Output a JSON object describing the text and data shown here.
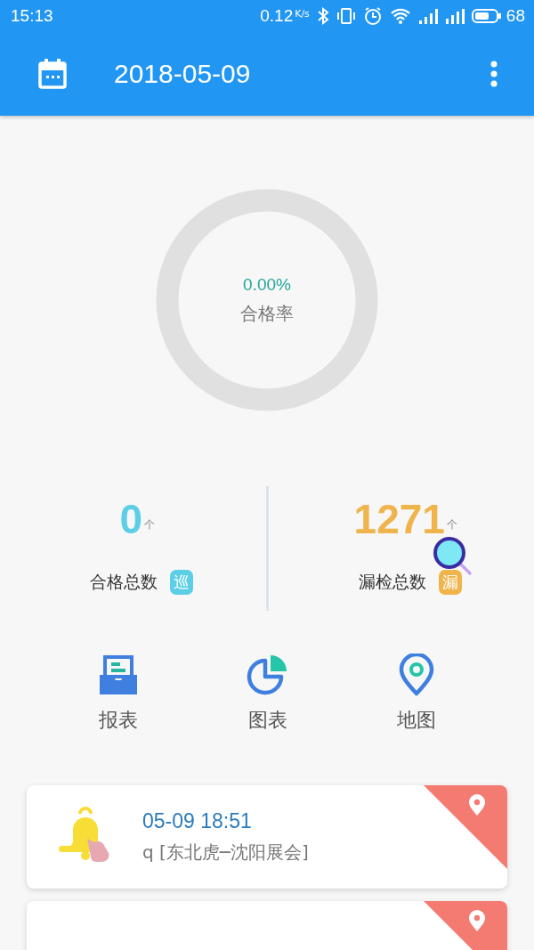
{
  "status_bar": {
    "time": "15:13",
    "speed": "0.12",
    "speed_unit": "K/s",
    "battery": "68"
  },
  "app_bar": {
    "title": "2018-05-09"
  },
  "rate": {
    "value": "0.00%",
    "label": "合格率",
    "level": 0
  },
  "stats": [
    {
      "kind": "pass",
      "value": "0",
      "unit": "个",
      "label": "合格总数",
      "tag": "巡",
      "color": "#5ccfe6"
    },
    {
      "kind": "miss",
      "value": "1271",
      "unit": "个",
      "label": "漏检总数",
      "tag": "漏",
      "color": "#f0b44c"
    }
  ],
  "menu": [
    {
      "kind": "report",
      "label": "报表"
    },
    {
      "kind": "chart",
      "label": "图表"
    },
    {
      "kind": "map",
      "label": "地图"
    }
  ],
  "alerts": [
    {
      "kind": "full",
      "time": "05-09 18:51",
      "text": "q [东北虎─沈阳展会]"
    },
    {
      "kind": "cut"
    }
  ]
}
